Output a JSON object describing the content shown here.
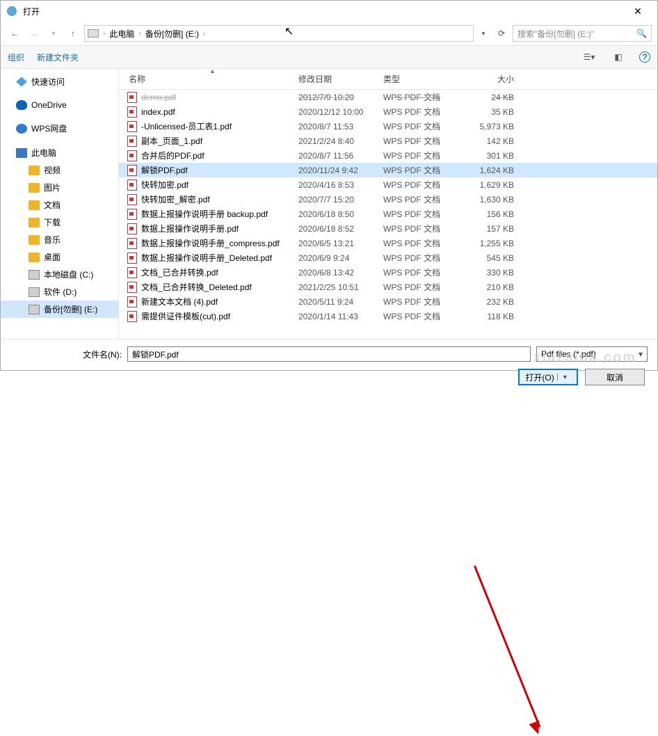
{
  "window": {
    "title": "打开"
  },
  "breadcrumb": {
    "pc": "此电脑",
    "drive": "备份[勿删] (E:)"
  },
  "search": {
    "placeholder": "搜索\"备份[勿删] (E:)\""
  },
  "toolbar": {
    "organize": "组织",
    "newfolder": "新建文件夹"
  },
  "sidebar": {
    "quick": "快速访问",
    "onedrive": "OneDrive",
    "wps": "WPS网盘",
    "pc": "此电脑",
    "video": "视频",
    "pictures": "图片",
    "documents": "文档",
    "downloads": "下载",
    "music": "音乐",
    "desktop": "桌面",
    "drivec": "本地磁盘 (C:)",
    "drived": "软件 (D:)",
    "drivee": "备份[勿删] (E:)"
  },
  "columns": {
    "name": "名称",
    "date": "修改日期",
    "type": "类型",
    "size": "大小"
  },
  "files": [
    {
      "name": "demo.pdf",
      "date": "2012/7/9 10:20",
      "type": "WPS PDF 文档",
      "size": "24 KB",
      "cut": true
    },
    {
      "name": "index.pdf",
      "date": "2020/12/12 10:00",
      "type": "WPS PDF 文档",
      "size": "35 KB"
    },
    {
      "name": "-Unlicensed-员工表1.pdf",
      "date": "2020/8/7 11:53",
      "type": "WPS PDF 文档",
      "size": "5,973 KB"
    },
    {
      "name": "副本_页面_1.pdf",
      "date": "2021/2/24 8:40",
      "type": "WPS PDF 文档",
      "size": "142 KB"
    },
    {
      "name": "合并后的PDF.pdf",
      "date": "2020/8/7 11:56",
      "type": "WPS PDF 文档",
      "size": "301 KB"
    },
    {
      "name": "解锁PDF.pdf",
      "date": "2020/11/24 9:42",
      "type": "WPS PDF 文档",
      "size": "1,624 KB",
      "sel": true
    },
    {
      "name": "快转加密.pdf",
      "date": "2020/4/16 8:53",
      "type": "WPS PDF 文档",
      "size": "1,629 KB"
    },
    {
      "name": "快转加密_解密.pdf",
      "date": "2020/7/7 15:20",
      "type": "WPS PDF 文档",
      "size": "1,630 KB"
    },
    {
      "name": "数据上报操作说明手册 backup.pdf",
      "date": "2020/6/18 8:50",
      "type": "WPS PDF 文档",
      "size": "156 KB"
    },
    {
      "name": "数据上报操作说明手册.pdf",
      "date": "2020/6/18 8:52",
      "type": "WPS PDF 文档",
      "size": "157 KB"
    },
    {
      "name": "数据上报操作说明手册_compress.pdf",
      "date": "2020/6/5 13:21",
      "type": "WPS PDF 文档",
      "size": "1,255 KB"
    },
    {
      "name": "数据上报操作说明手册_Deleted.pdf",
      "date": "2020/6/9 9:24",
      "type": "WPS PDF 文档",
      "size": "545 KB"
    },
    {
      "name": "文档_已合并转换.pdf",
      "date": "2020/6/8 13:42",
      "type": "WPS PDF 文档",
      "size": "330 KB"
    },
    {
      "name": "文档_已合并转换_Deleted.pdf",
      "date": "2021/2/25 10:51",
      "type": "WPS PDF 文档",
      "size": "210 KB"
    },
    {
      "name": "新建文本文档 (4).pdf",
      "date": "2020/5/11 9:24",
      "type": "WPS PDF 文档",
      "size": "232 KB"
    },
    {
      "name": "需提供证件模板(cut).pdf",
      "date": "2020/1/14 11:43",
      "type": "WPS PDF 文档",
      "size": "118 KB"
    }
  ],
  "footer": {
    "filename_label": "文件名(N):",
    "filename_value": "解锁PDF.pdf",
    "filter": "Pdf files (*.pdf)",
    "open": "打开(O)",
    "cancel": "取消"
  },
  "watermark": "xiazaiba.com"
}
